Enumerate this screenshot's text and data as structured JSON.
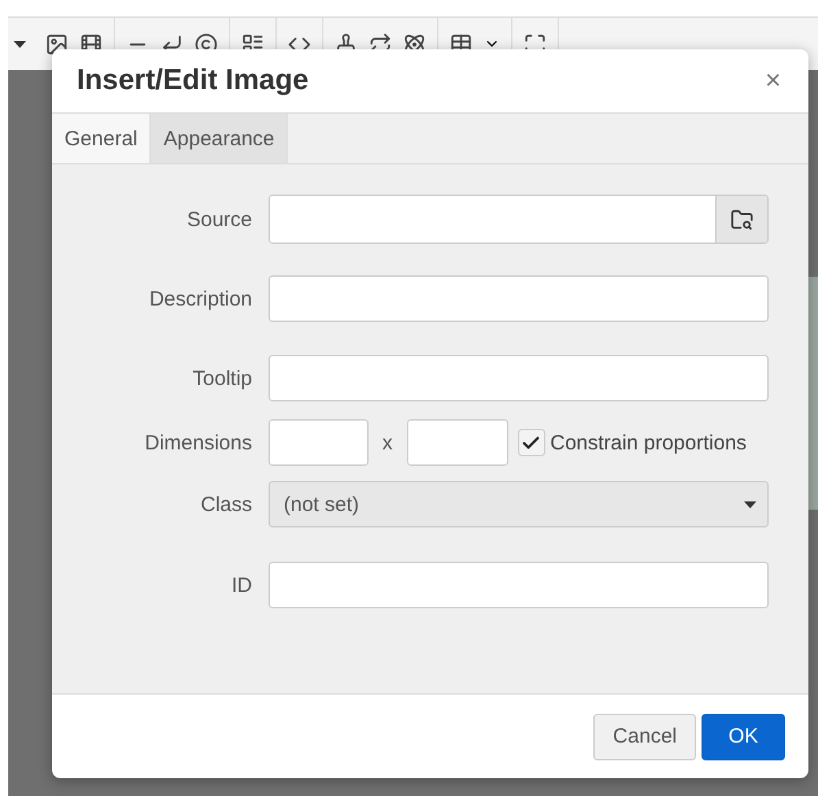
{
  "dialog": {
    "title": "Insert/Edit Image",
    "close": "×",
    "tabs": [
      {
        "label": "General",
        "selected": true
      },
      {
        "label": "Appearance",
        "selected": false
      }
    ],
    "fields": [
      {
        "kind": "browse",
        "label": "Source"
      },
      {
        "kind": "text",
        "label": "Description"
      },
      {
        "kind": "text",
        "label": "Tooltip"
      },
      {
        "kind": "dimensions",
        "label": "Dimensions",
        "separator": "x",
        "constrain": {
          "label": "Constrain proportions",
          "checked": true
        }
      },
      {
        "kind": "select",
        "label": "Class",
        "value": "(not set)"
      },
      {
        "kind": "text",
        "label": "ID"
      }
    ],
    "buttons": [
      {
        "label": "Cancel",
        "kind": "secondary"
      },
      {
        "label": "OK",
        "kind": "primary"
      }
    ]
  }
}
